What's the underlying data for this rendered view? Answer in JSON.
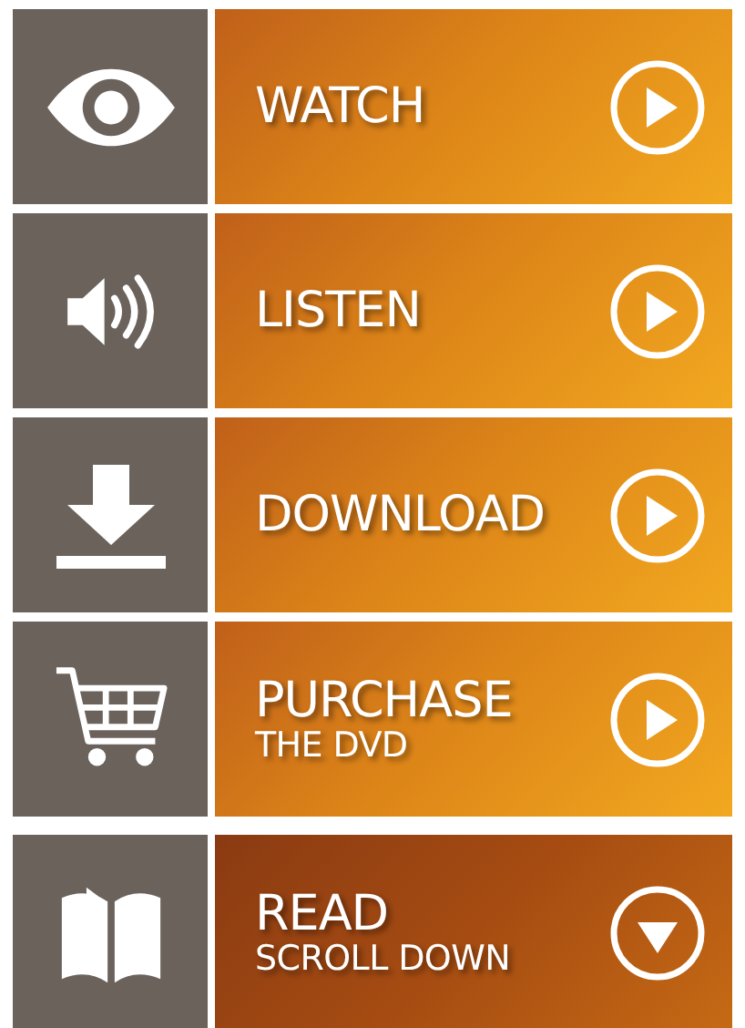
{
  "menu": [
    {
      "kind": "play",
      "title": "WATCH"
    },
    {
      "kind": "play",
      "title": "LISTEN"
    },
    {
      "kind": "play",
      "title": "DOWNLOAD"
    },
    {
      "kind": "play",
      "title": "PURCHASE",
      "subtitle": "THE DVD"
    },
    {
      "kind": "scroll",
      "title": "READ",
      "subtitle": "SCROLL DOWN"
    }
  ]
}
